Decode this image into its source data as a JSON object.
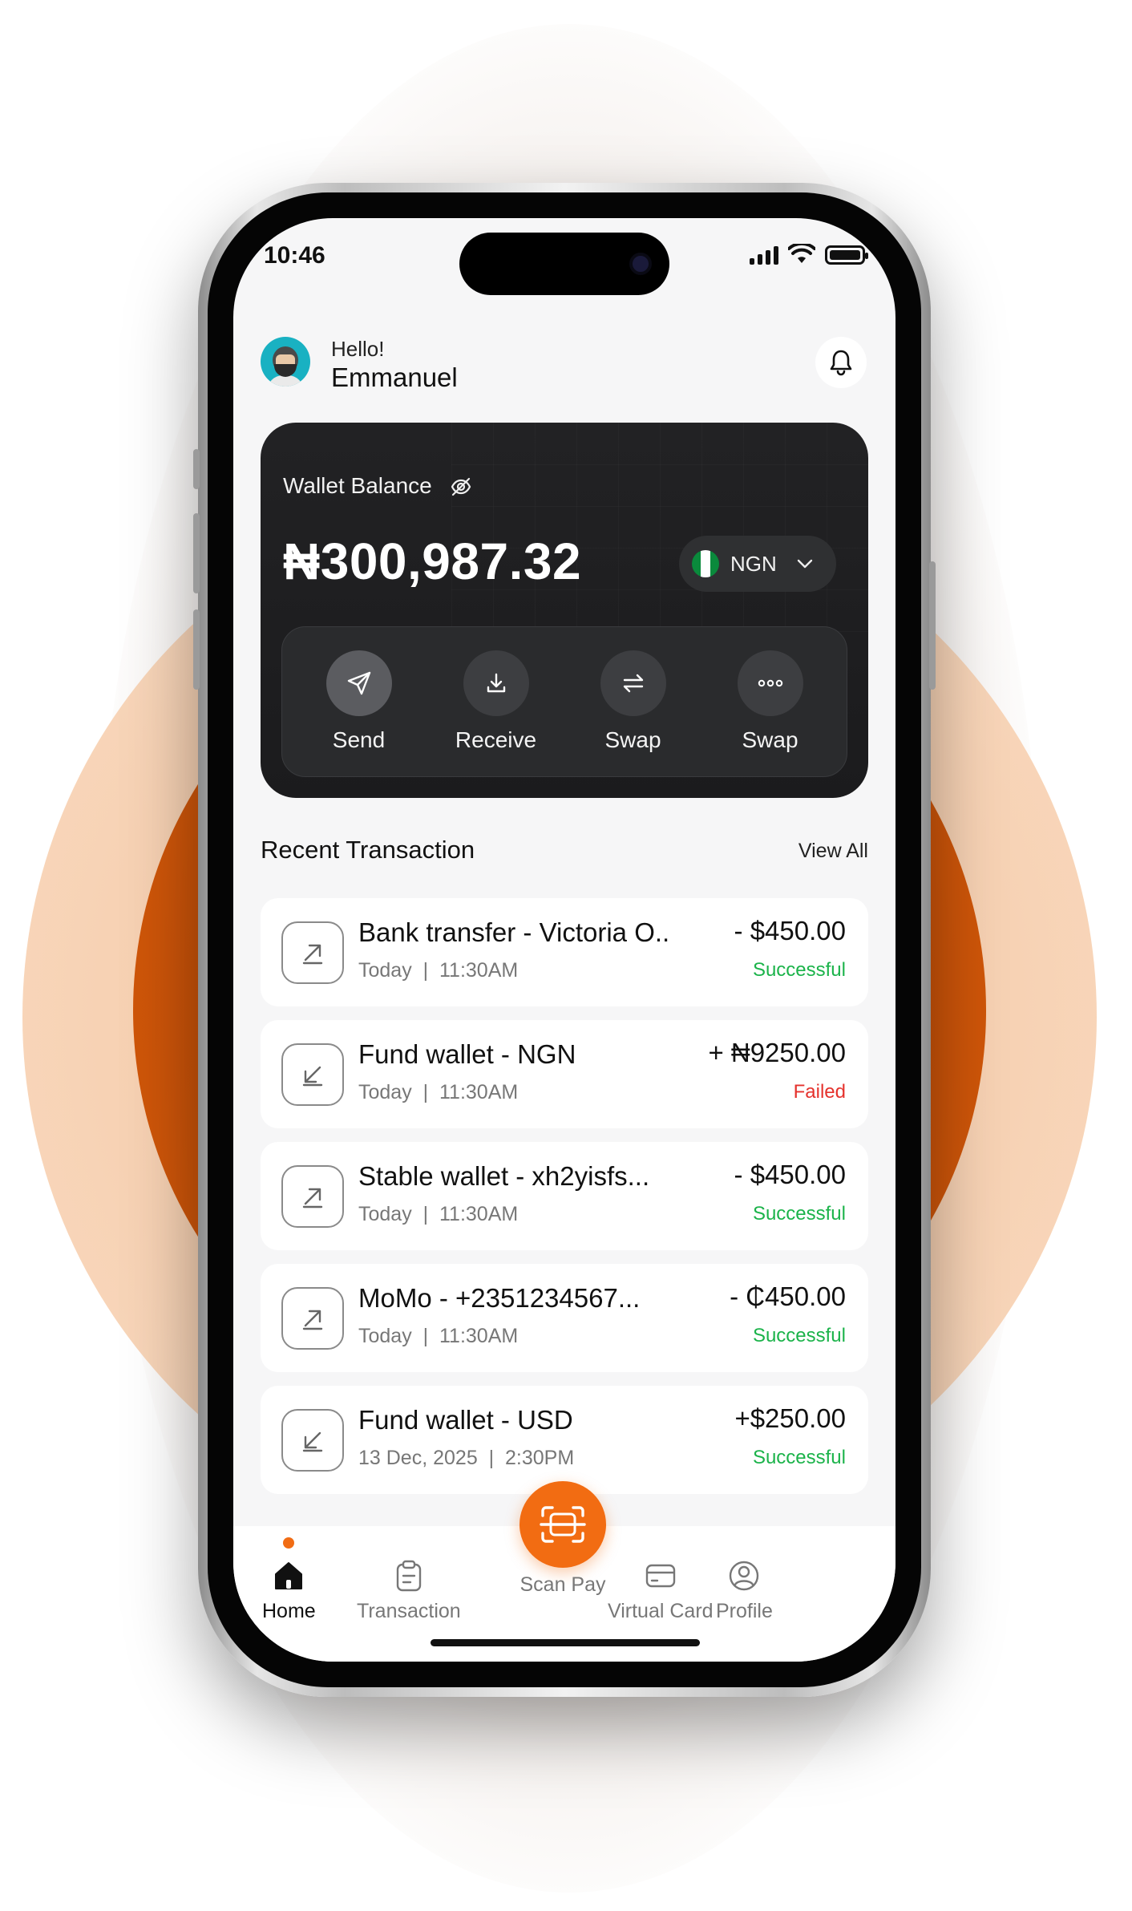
{
  "status_bar": {
    "time": "10:46"
  },
  "header": {
    "hello": "Hello!",
    "name": "Emmanuel"
  },
  "wallet": {
    "label": "Wallet Balance",
    "amount": "₦300,987.32",
    "currency": "NGN",
    "actions": [
      {
        "label": "Send",
        "icon": "send-icon"
      },
      {
        "label": "Receive",
        "icon": "download-icon"
      },
      {
        "label": "Swap",
        "icon": "swap-icon"
      },
      {
        "label": "Swap",
        "icon": "more-icon"
      }
    ]
  },
  "recent": {
    "title": "Recent Transaction",
    "view_all": "View All",
    "items": [
      {
        "title": "Bank transfer - Victoria O..",
        "date": "Today",
        "time": "11:30AM",
        "amount": "- $450.00",
        "status": "Successful",
        "direction": "out"
      },
      {
        "title": "Fund wallet - NGN",
        "date": "Today",
        "time": "11:30AM",
        "amount": "+ ₦9250.00",
        "status": "Failed",
        "direction": "in"
      },
      {
        "title": "Stable wallet - xh2yisfs...",
        "date": "Today",
        "time": "11:30AM",
        "amount": "- $450.00",
        "status": "Successful",
        "direction": "out"
      },
      {
        "title": "MoMo - +2351234567...",
        "date": "Today",
        "time": "11:30AM",
        "amount": "- ₵450.00",
        "status": "Successful",
        "direction": "out"
      },
      {
        "title": "Fund wallet - USD",
        "date": "13 Dec, 2025",
        "time": "2:30PM",
        "amount": "+$250.00",
        "status": "Successful",
        "direction": "in"
      }
    ]
  },
  "nav": {
    "home": "Home",
    "transaction": "Transaction",
    "scan_pay": "Scan Pay",
    "virtual_card": "Virtual Card",
    "profile": "Profile"
  },
  "colors": {
    "accent": "#f26c12",
    "success": "#1bb34a",
    "failed": "#e5322d",
    "card_dark": "#1e1e20"
  }
}
